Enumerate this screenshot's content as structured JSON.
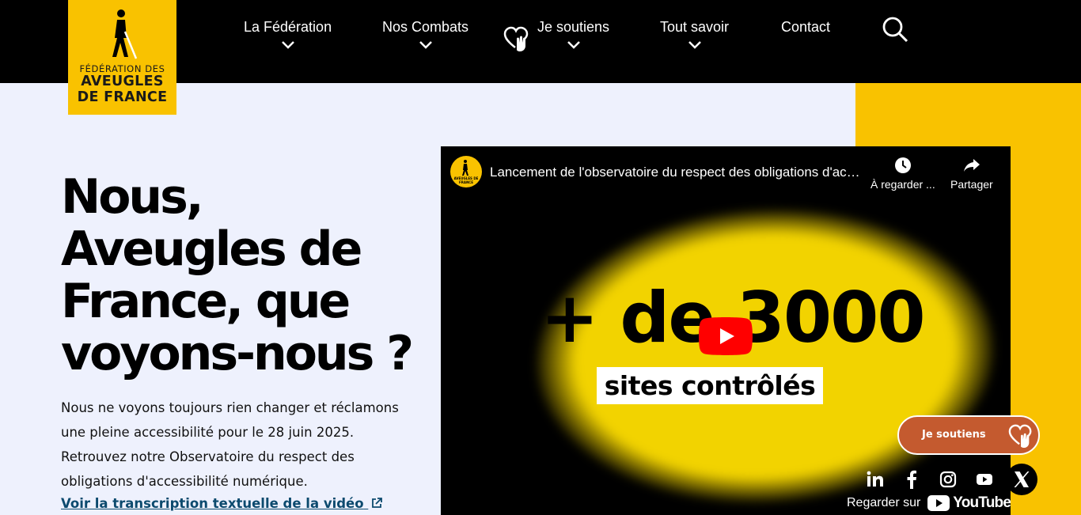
{
  "header": {
    "logo": {
      "line1": "FÉDÉRATION DES",
      "line2": "AVEUGLES",
      "line3": "DE FRANCE"
    },
    "nav": [
      {
        "label": "La Fédération"
      },
      {
        "label": "Nos Combats"
      },
      {
        "label": "Je soutiens"
      },
      {
        "label": "Tout savoir"
      },
      {
        "label": "Contact"
      }
    ]
  },
  "hero": {
    "title_lines": [
      "Nous,",
      "Aveugles de",
      "France, que",
      "voyons-nous ?"
    ],
    "text": "Nous ne voyons toujours rien changer et réclamons une pleine accessibilité pour le 28 juin 2025. Retrouvez notre Observatoire du respect des obligations d'accessibilité numérique.",
    "link": "Voir la transcription textuelle de la vidéo"
  },
  "video": {
    "title": "Lancement de l'observatoire du respect des obligations d'accessibilité numérique",
    "watch_later": "À regarder ...",
    "share": "Partager",
    "big_text": "+ de 3000",
    "sub_text": "sites contrôlés",
    "watch_on": "Regarder sur",
    "youtube_word": "YouTube",
    "channel_logo_text": "AVEUGLES DE FRANCE"
  },
  "floating": {
    "donate_label": "Je soutiens"
  },
  "colors": {
    "brand_yellow": "#f9c200",
    "background": "#eef1fd",
    "donate": "#c45a2f",
    "link": "#0c4a6e"
  },
  "social_icons": [
    "linkedin-icon",
    "facebook-icon",
    "instagram-icon",
    "youtube-icon",
    "x-icon"
  ]
}
